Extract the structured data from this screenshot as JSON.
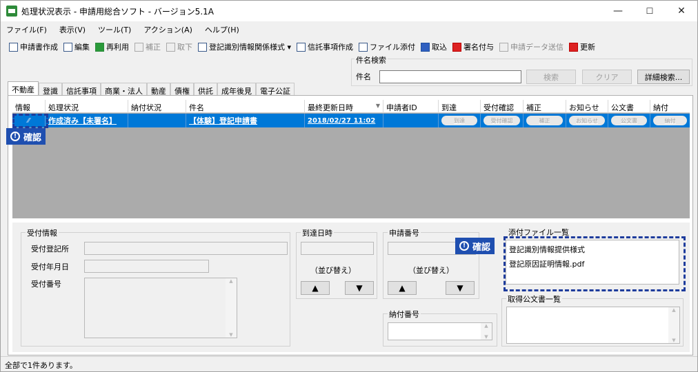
{
  "window": {
    "title": "処理状況表示 - 申請用総合ソフト - バージョン5.1A",
    "min": "—",
    "max": "☐",
    "close": "✕"
  },
  "menu": [
    "ファイル(F)",
    "表示(V)",
    "ツール(T)",
    "アクション(A)",
    "ヘルプ(H)"
  ],
  "toolbar": [
    {
      "label": "申請書作成",
      "icon": "form-icon",
      "enabled": true
    },
    {
      "label": "編集",
      "icon": "edit-icon",
      "enabled": true
    },
    {
      "label": "再利用",
      "icon": "reuse-icon",
      "enabled": true
    },
    {
      "label": "補正",
      "icon": "correction-icon",
      "enabled": false
    },
    {
      "label": "取下",
      "icon": "withdraw-icon",
      "enabled": false
    },
    {
      "label": "登記識別情報関係様式 ▾",
      "icon": "registry-form-icon",
      "enabled": true
    },
    {
      "label": "信託事項作成",
      "icon": "trust-icon",
      "enabled": true
    },
    {
      "label": "ファイル添付",
      "icon": "attach-icon",
      "enabled": true
    },
    {
      "label": "取込",
      "icon": "import-icon",
      "enabled": true
    },
    {
      "label": "署名付与",
      "icon": "sign-icon",
      "enabled": true
    },
    {
      "label": "申請データ送信",
      "icon": "send-icon",
      "enabled": false
    },
    {
      "label": "更新",
      "icon": "refresh-icon",
      "enabled": true
    }
  ],
  "search": {
    "group": "件名検索",
    "label": "件名",
    "value": "",
    "search_btn": "検索",
    "clear_btn": "クリア",
    "detail_btn": "詳細検索..."
  },
  "tabs": [
    "不動産",
    "登識",
    "信託事項",
    "商業・法人",
    "動産",
    "債権",
    "供託",
    "成年後見",
    "電子公証"
  ],
  "grid": {
    "headers": [
      "情報",
      "処理状況",
      "納付状況",
      "件名",
      "最終更新日時",
      "申請者ID",
      "到達",
      "受付確認",
      "補正",
      "お知らせ",
      "公文書",
      "納付"
    ],
    "row": {
      "status": "作成済み【未署名】",
      "payment": "",
      "subject": "【体験】登記申請書",
      "updated": "2018/02/27 11:02",
      "applicant": "",
      "pills": [
        "到達",
        "受付確認",
        "補正",
        "お知らせ",
        "公文書",
        "納付"
      ]
    }
  },
  "badge": {
    "icon": "!",
    "label": "確認"
  },
  "reception": {
    "group": "受付情報",
    "office_label": "受付登記所",
    "date_label": "受付年月日",
    "number_label": "受付番号"
  },
  "arrival": {
    "group": "到達日時",
    "sort_label": "（並び替え）",
    "up": "▲",
    "down": "▼"
  },
  "application_no": {
    "group": "申請番号",
    "sort_label": "（並び替え）",
    "up": "▲",
    "down": "▼"
  },
  "payment_no": {
    "group": "納付番号"
  },
  "attachments": {
    "group": "添付ファイル一覧",
    "items": [
      "登記識別情報提供様式",
      "登記原因証明情報.pdf"
    ]
  },
  "documents": {
    "group": "取得公文書一覧"
  },
  "status": "全部で1件あります。"
}
